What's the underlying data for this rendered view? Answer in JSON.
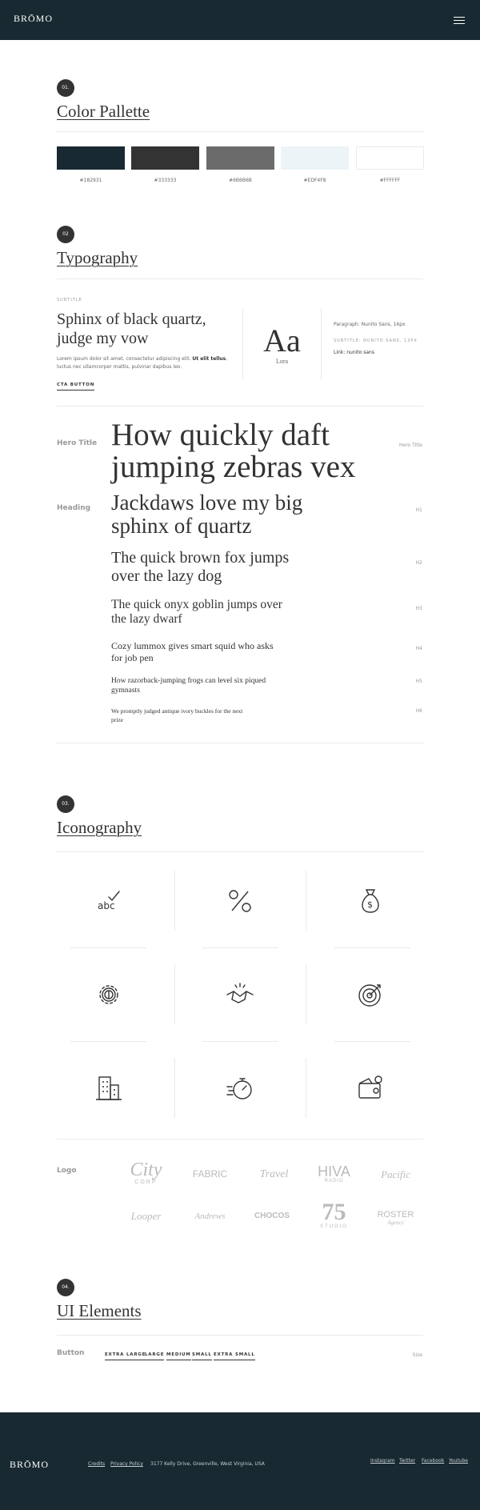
{
  "header": {
    "brand": "BRŌMO"
  },
  "sections": {
    "s1": {
      "num": "01.",
      "title": "Color Pallette"
    },
    "s2": {
      "num": "02",
      "title": "Typography"
    },
    "s3": {
      "num": "03.",
      "title": "Iconography"
    },
    "s4": {
      "num": "04.",
      "title": "UI Elements"
    }
  },
  "colors": [
    {
      "hex": "#182931",
      "label": "#182931"
    },
    {
      "hex": "#333333",
      "label": "#333333"
    },
    {
      "hex": "#6B6B6B",
      "label": "#6B6B6B"
    },
    {
      "hex": "#EDF4F8",
      "label": "#EDF4F8"
    },
    {
      "hex": "#FFFFFF",
      "label": "#FFFFFF"
    }
  ],
  "typo": {
    "subtitle": "SUBTITLE",
    "sample_heading": "Sphinx of black quartz, judge my vow",
    "body_pre": "Lorem ipsum dolor sit amet, consectetur adipiscing elit. ",
    "body_bold": "Ut elit tellus",
    "body_post": ", luctus nec ullamcorper mattis, pulvinar dapibus leo.",
    "cta": "CTA BUTTON",
    "aa": "Aa",
    "font_name": "Lora",
    "paragraph_spec": "Paragraph: Nunito Sans, 16px",
    "subtitle_spec": "SUBTITLE: NUNITO SANS, 13PX",
    "link_spec": "Link: nunito sans"
  },
  "scale": {
    "hero_label": "Hero Title",
    "heading_label": "Heading",
    "rows": [
      {
        "text": "How quickly daft jumping zebras vex",
        "tag": "Hero Title"
      },
      {
        "text": "Jackdaws love my big sphinx of quartz",
        "tag": "H1"
      },
      {
        "text": "The quick brown fox jumps over the lazy dog",
        "tag": "H2"
      },
      {
        "text": "The quick onyx goblin jumps over the lazy dwarf",
        "tag": "H3"
      },
      {
        "text": "Cozy lummox gives smart squid who asks for job pen",
        "tag": "H4"
      },
      {
        "text": "How razorback-jumping frogs can level six piqued gymnasts",
        "tag": "H5"
      },
      {
        "text": "We promptly judged antique ivory buckles for the next prize",
        "tag": "H6"
      }
    ]
  },
  "icons": [
    "spellcheck-icon",
    "percent-icon",
    "money-bag-icon",
    "gear-dollar-icon",
    "handshake-icon",
    "target-icon",
    "buildings-icon",
    "stopwatch-icon",
    "wallet-icon"
  ],
  "logos": {
    "label": "Logo",
    "items": [
      {
        "name": "City",
        "sub": "CORP"
      },
      {
        "name": "FABRIC",
        "sub": ""
      },
      {
        "name": "Travel",
        "sub": ""
      },
      {
        "name": "HIVA",
        "sub": "RADIO"
      },
      {
        "name": "Pacific",
        "sub": ""
      },
      {
        "name": "Looper",
        "sub": ""
      },
      {
        "name": "Andrews",
        "sub": ""
      },
      {
        "name": "CHOCOS",
        "sub": ""
      },
      {
        "name": "75",
        "sub": "STUDIO"
      },
      {
        "name": "ROSTER",
        "sub": "Agency"
      }
    ]
  },
  "ui": {
    "button_label": "Button",
    "size_label": "Size",
    "buttons": [
      "EXTRA LARGE",
      "LARGE",
      "MEDIUM",
      "SMALL",
      "EXTRA SMALL"
    ]
  },
  "footer": {
    "brand": "BRŌMO",
    "credits": "Credits",
    "privacy": "Privacy Policy",
    "address": "3177 Kelly Drive, Greenville, West Virginia, USA",
    "social": [
      "Instagram",
      "Twitter",
      "Facebook",
      "Youtube"
    ]
  }
}
